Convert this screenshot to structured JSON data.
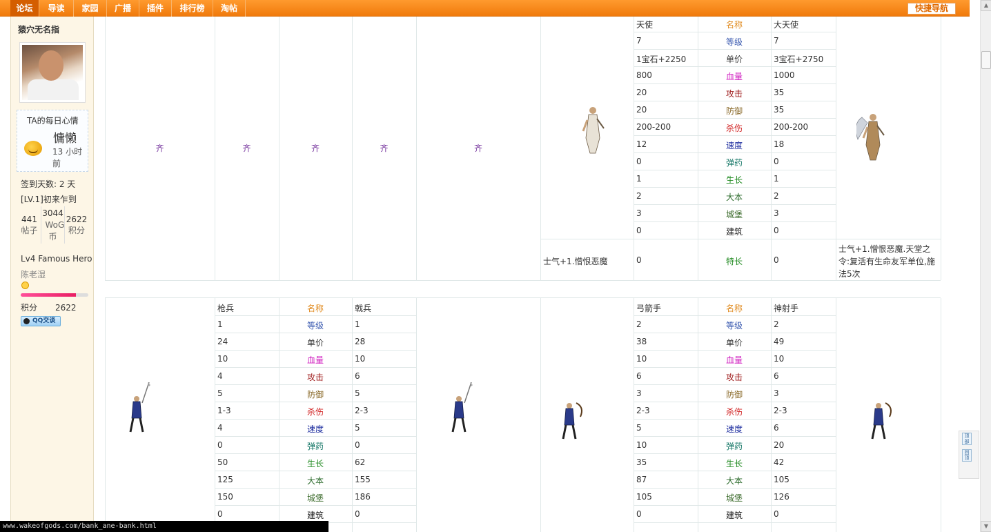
{
  "nav": {
    "items": [
      "论坛",
      "导读",
      "家园",
      "广播",
      "插件",
      "排行榜",
      "淘帖"
    ],
    "quick_nav": "快捷导航"
  },
  "sidebar": {
    "username": "猿穴无名指",
    "mood_title": "TA的每日心情",
    "mood_text": "慵懒",
    "mood_time": "13 小时前",
    "signin": "签到天数: 2 天",
    "level_title": "[LV.1]初来乍到",
    "stats": [
      {
        "num": "441",
        "label": "帖子"
      },
      {
        "num": "3044",
        "label": "WoG币"
      },
      {
        "num": "2622",
        "label": "积分"
      }
    ],
    "hero_level": "Lv4 Famous Hero",
    "group": "陈老湿",
    "progress": 0.82,
    "points_label": "积分",
    "points_value": "2622",
    "qq_label": "QQ交谈"
  },
  "table": {
    "qi": "齐",
    "labels": [
      "名称",
      "等级",
      "单价",
      "血量",
      "攻击",
      "防御",
      "杀伤",
      "速度",
      "弹药",
      "生长",
      "大本",
      "城堡",
      "建筑"
    ],
    "angel": {
      "left": [
        "天使",
        "7",
        "1宝石+2250",
        "800",
        "20",
        "20",
        "200-200",
        "12",
        "0",
        "1",
        "2",
        "3",
        "0"
      ],
      "right": [
        "大天使",
        "7",
        "3宝石+2750",
        "1000",
        "35",
        "35",
        "200-200",
        "18",
        "0",
        "1",
        "2",
        "3",
        "0"
      ],
      "spec_label": "特长",
      "spec_left_desc": "士气+1.憎恨恶魔",
      "spec_left": "0",
      "spec_right": "0",
      "spec_right_desc": "士气+1.憎恨恶魔.天堂之令:复活有生命友军单位,施法5次"
    },
    "pike": {
      "left": [
        "枪兵",
        "1",
        "24",
        "10",
        "4",
        "5",
        "1-3",
        "4",
        "0",
        "50",
        "125",
        "150",
        "0"
      ],
      "right": [
        "戟兵",
        "1",
        "28",
        "10",
        "6",
        "5",
        "2-3",
        "5",
        "0",
        "62",
        "155",
        "186",
        "0"
      ]
    },
    "archer": {
      "left": [
        "弓箭手",
        "2",
        "38",
        "10",
        "6",
        "3",
        "2-3",
        "5",
        "10",
        "35",
        "87",
        "105",
        "0"
      ],
      "right": [
        "神射手",
        "2",
        "49",
        "10",
        "6",
        "3",
        "2-3",
        "6",
        "20",
        "42",
        "105",
        "126",
        "0"
      ]
    }
  },
  "status_url": "www.wakeofgods.com/bank_ane-bank.html",
  "floater": {
    "top": "顶部",
    "back": "回顶"
  }
}
